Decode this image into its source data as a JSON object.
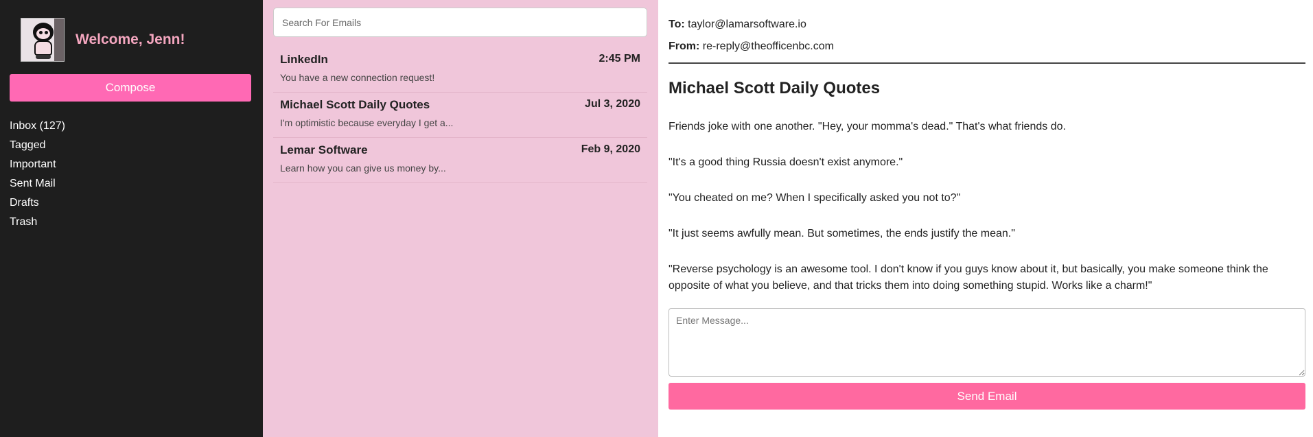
{
  "sidebar": {
    "welcome": "Welcome, Jenn!",
    "compose_label": "Compose",
    "nav": [
      "Inbox (127)",
      "Tagged",
      "Important",
      "Sent Mail",
      "Drafts",
      "Trash"
    ]
  },
  "search": {
    "placeholder": "Search For Emails"
  },
  "emails": [
    {
      "sender": "LinkedIn",
      "date": "2:45 PM",
      "preview": "You have a new connection request!"
    },
    {
      "sender": "Michael Scott Daily Quotes",
      "date": "Jul 3, 2020",
      "preview": "I'm optimistic because everyday I get a..."
    },
    {
      "sender": "Lemar Software",
      "date": "Feb 9, 2020",
      "preview": "Learn how you can give us money by..."
    }
  ],
  "reader": {
    "to_label": "To:",
    "to": "taylor@lamarsoftware.io",
    "from_label": "From:",
    "from": "re-reply@theofficenbc.com",
    "subject": "Michael Scott Daily Quotes",
    "quotes": [
      "Friends joke with one another. \"Hey, your momma's dead.\" That's what friends do.",
      "\"It's a good thing Russia doesn't exist anymore.\"",
      "\"You cheated on me? When I specifically asked you not to?\"",
      "\"It just seems awfully mean. But sometimes, the ends justify the mean.\"",
      "\"Reverse psychology is an awesome tool. I don't know if you guys know about it, but basically, you make someone think the opposite of what you believe, and that tricks them into doing something stupid. Works like a charm!\""
    ],
    "message_placeholder": "Enter Message...",
    "send_label": "Send Email"
  },
  "colors": {
    "sidebar_bg": "#1e1e1e",
    "accent": "#ff69b4",
    "list_bg": "#f0c6da",
    "welcome": "#f4a6bf"
  }
}
